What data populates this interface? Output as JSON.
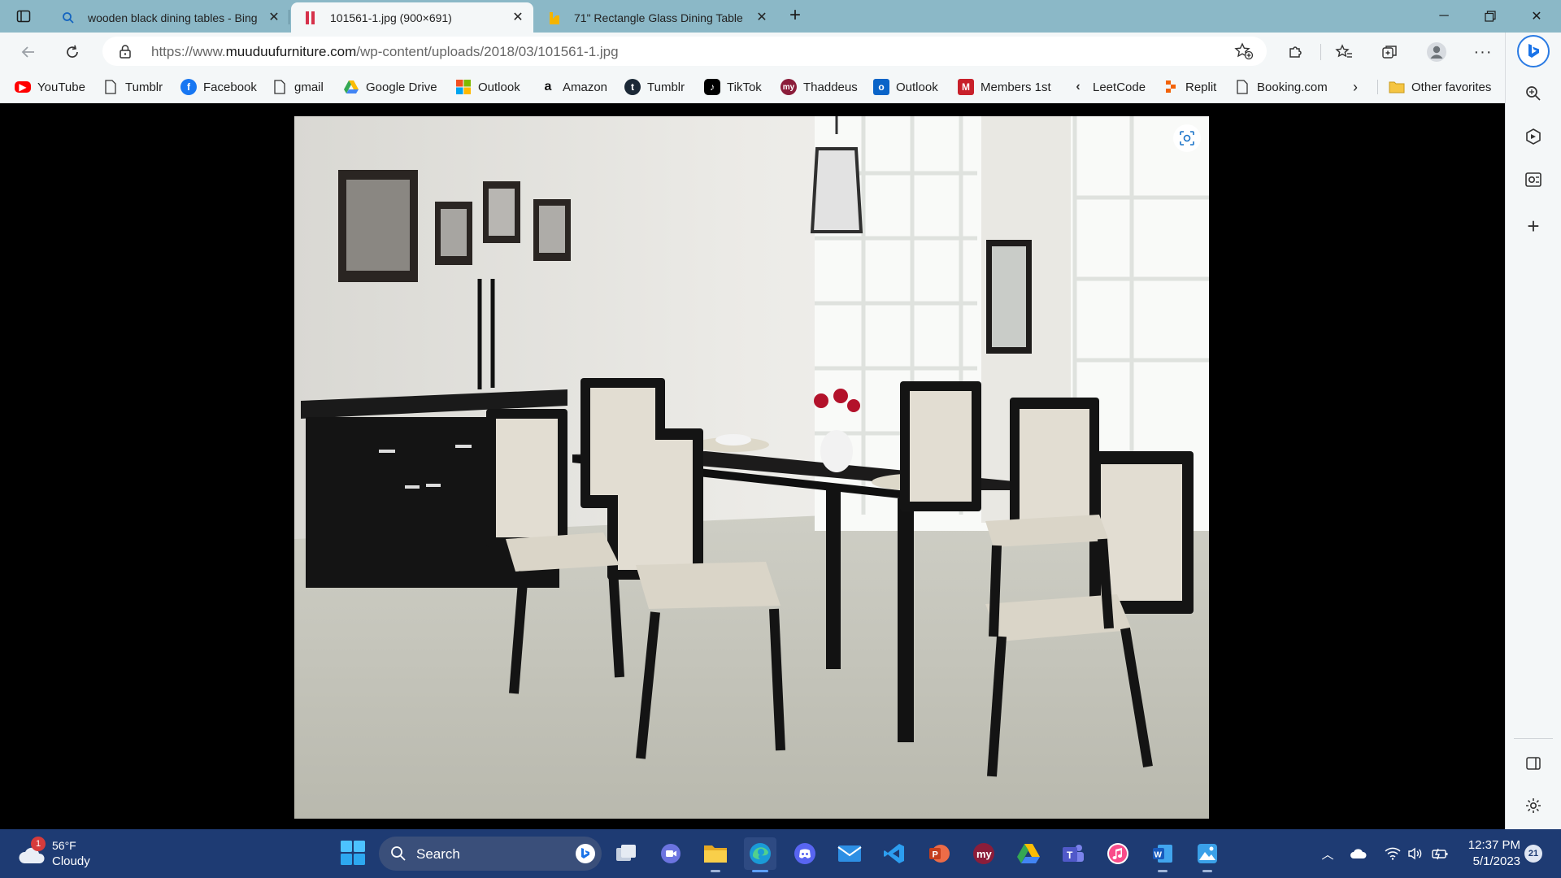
{
  "browser": {
    "tabs": [
      {
        "title": "wooden black dining tables - Bing",
        "icon": "bing-search-icon",
        "active": false
      },
      {
        "title": "101561-1.jpg (900×691)",
        "icon": "image-favicon",
        "active": true
      },
      {
        "title": "71\" Rectangle Glass Dining Table",
        "icon": "wayfair-favicon",
        "active": false
      }
    ],
    "url": {
      "scheme": "https://www.",
      "domain": "muuduufurniture.com",
      "path": "/wp-content/uploads/2018/03/101561-1.jpg"
    },
    "favorites": [
      {
        "label": "YouTube",
        "icon": "youtube-icon",
        "color": "#ff0000"
      },
      {
        "label": "Tumblr",
        "icon": "page-icon",
        "color": ""
      },
      {
        "label": "Facebook",
        "icon": "facebook-icon",
        "color": "#1877f2"
      },
      {
        "label": "gmail",
        "icon": "page-icon",
        "color": ""
      },
      {
        "label": "Google Drive",
        "icon": "google-drive-icon",
        "color": "#34a853"
      },
      {
        "label": "Outlook",
        "icon": "microsoft-icon",
        "color": "#f25022"
      },
      {
        "label": "Amazon",
        "icon": "amazon-icon",
        "color": "#111111"
      },
      {
        "label": "Tumblr",
        "icon": "tumblr-icon",
        "color": "#1b2836"
      },
      {
        "label": "TikTok",
        "icon": "tiktok-icon",
        "color": "#000000"
      },
      {
        "label": "Thaddeus",
        "icon": "my-icon",
        "color": "#8b1d3a"
      },
      {
        "label": "Outlook",
        "icon": "outlook-icon",
        "color": "#0a64c8"
      },
      {
        "label": "Members 1st",
        "icon": "members1st-icon",
        "color": "#c8202a"
      },
      {
        "label": "LeetCode",
        "icon": "leetcode-icon",
        "color": "#333333"
      },
      {
        "label": "Replit",
        "icon": "replit-icon",
        "color": "#f26207"
      },
      {
        "label": "Booking.com",
        "icon": "page-icon",
        "color": ""
      }
    ],
    "other_favorites": "Other favorites"
  },
  "taskbar": {
    "weather": {
      "temp": "56°F",
      "condition": "Cloudy",
      "badge": "1"
    },
    "search_label": "Search",
    "apps": [
      {
        "name": "task-view-app",
        "icon": "task-view-icon",
        "color": "#d0d8e8"
      },
      {
        "name": "teams-meet-app",
        "icon": "meet-icon",
        "color": "#7b83eb"
      },
      {
        "name": "file-explorer-app",
        "icon": "folder-icon",
        "color": "#f5c542"
      },
      {
        "name": "edge-app",
        "icon": "edge-icon",
        "color": "#1fa8c9"
      },
      {
        "name": "discord-app",
        "icon": "discord-icon",
        "color": "#5865f2"
      },
      {
        "name": "mail-app",
        "icon": "mail-icon",
        "color": "#2d8fe4"
      },
      {
        "name": "vscode-app",
        "icon": "vscode-icon",
        "color": "#2c9ef0"
      },
      {
        "name": "powerpoint-app",
        "icon": "powerpoint-icon",
        "color": "#d35230"
      },
      {
        "name": "my-app",
        "icon": "my-icon",
        "color": "#8b1d3a"
      },
      {
        "name": "google-drive-app",
        "icon": "google-drive-icon",
        "color": "#34a853"
      },
      {
        "name": "teams-app",
        "icon": "teams-icon",
        "color": "#5b5fc7"
      },
      {
        "name": "itunes-app",
        "icon": "itunes-icon",
        "color": "#f94c8a"
      },
      {
        "name": "word-app",
        "icon": "word-icon",
        "color": "#2b579a"
      },
      {
        "name": "photos-app",
        "icon": "photos-icon",
        "color": "#3aa0e8"
      }
    ],
    "clock": {
      "time": "12:37 PM",
      "date": "5/1/2023"
    },
    "notifications": "21"
  }
}
